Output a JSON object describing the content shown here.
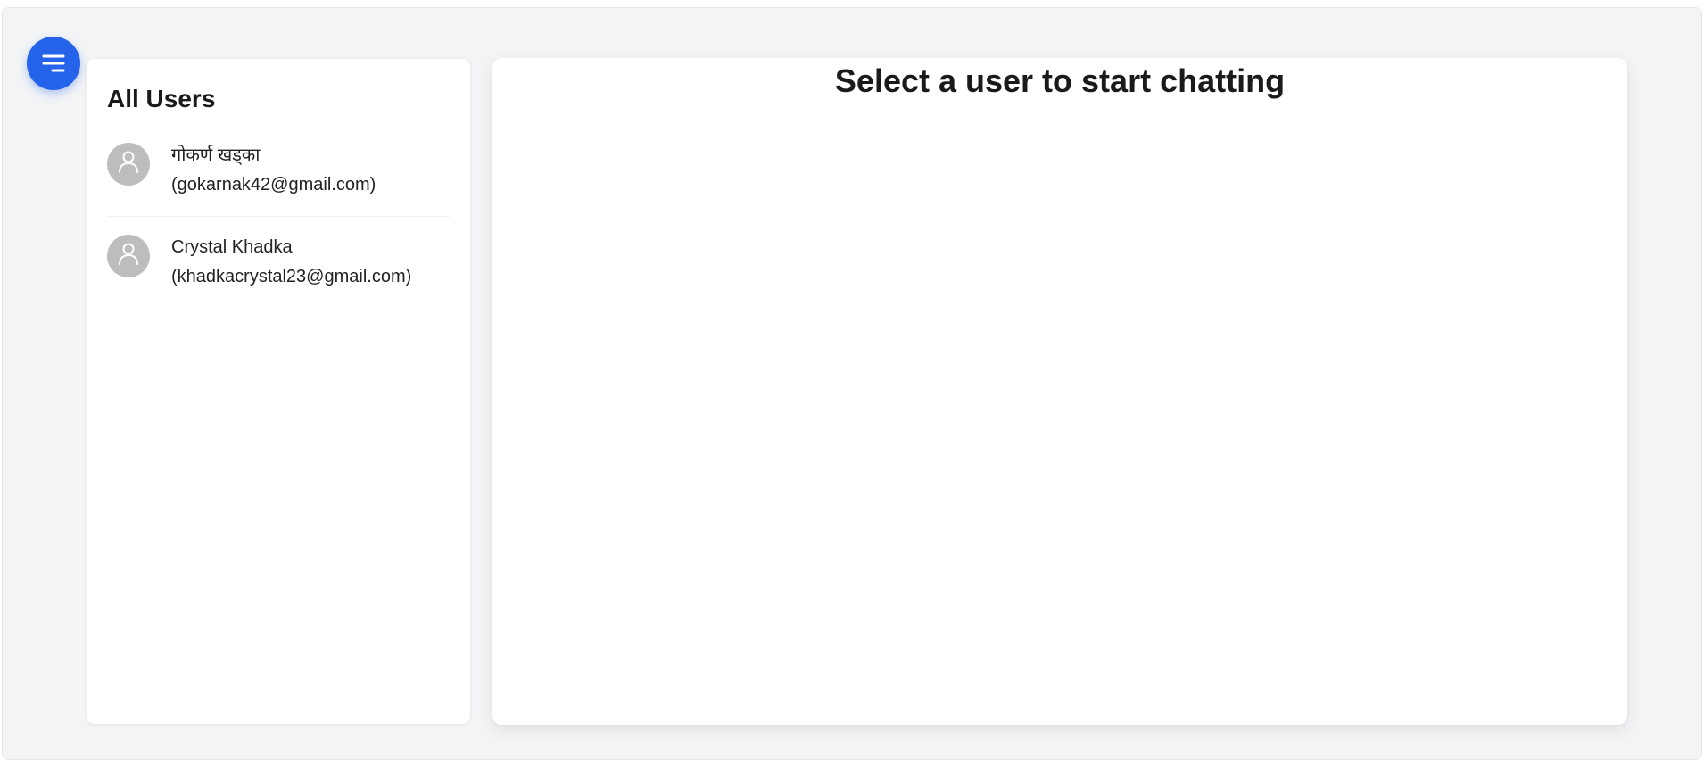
{
  "menu": {
    "icon": "menu-icon",
    "accent_color": "#2563eb"
  },
  "users_panel": {
    "title": "All Users",
    "users": [
      {
        "name": "गोकर्ण खड्का",
        "email": "(gokarnak42@gmail.com)",
        "avatar_icon": "user-icon"
      },
      {
        "name": "Crystal Khadka",
        "email": "(khadkacrystal23@gmail.com)",
        "avatar_icon": "user-icon"
      }
    ]
  },
  "chat_panel": {
    "placeholder": "Select a user to start chatting"
  }
}
